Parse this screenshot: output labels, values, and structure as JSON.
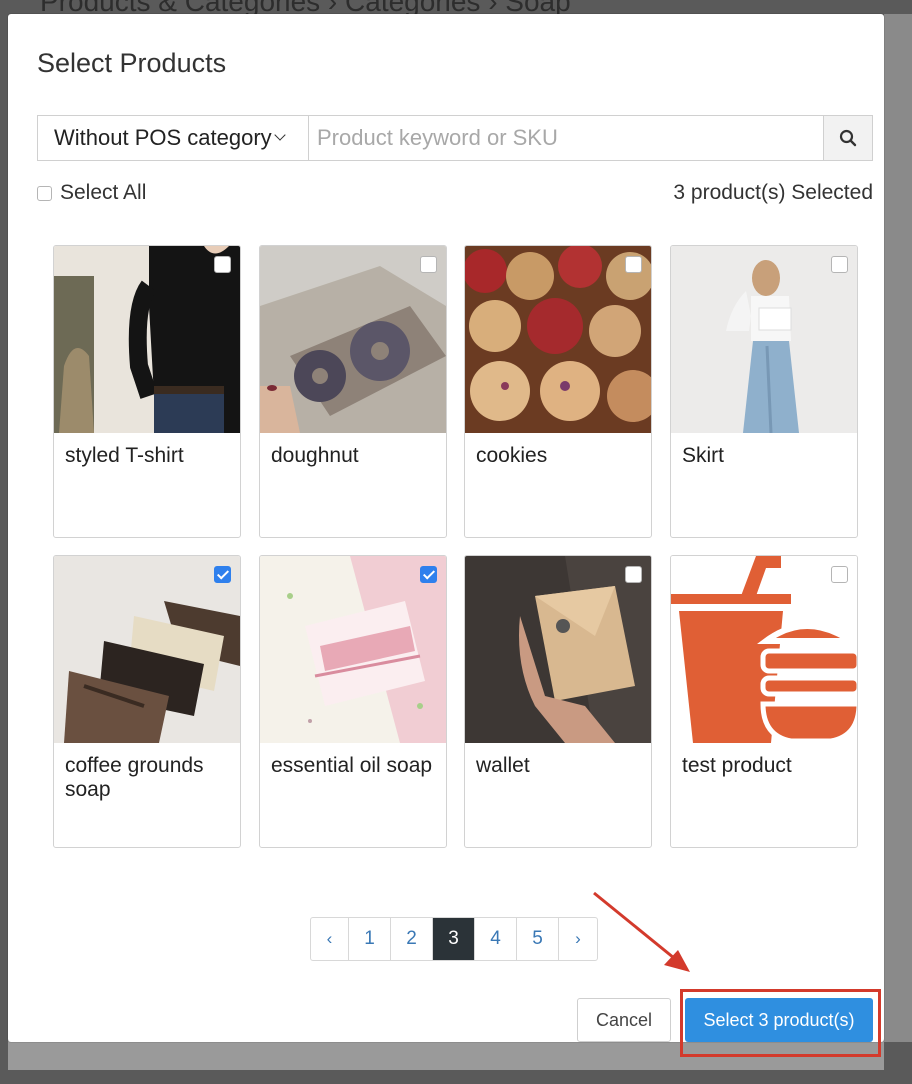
{
  "background": {
    "breadcrumb": "Products & Categories  ›  Categories  ›  Soap"
  },
  "modal": {
    "title": "Select Products",
    "category_filter": "Without POS category",
    "search_placeholder": "Product keyword or SKU",
    "select_all_label": "Select All",
    "selected_count_text": "3 product(s) Selected"
  },
  "products": [
    {
      "name": "styled T-shirt",
      "checked": false
    },
    {
      "name": "doughnut",
      "checked": false
    },
    {
      "name": "cookies",
      "checked": false
    },
    {
      "name": "Skirt",
      "checked": false
    },
    {
      "name": "coffee grounds soap",
      "checked": true
    },
    {
      "name": "essential oil soap",
      "checked": true
    },
    {
      "name": "wallet",
      "checked": false
    },
    {
      "name": "test product",
      "checked": false
    }
  ],
  "pagination": {
    "prev": "‹",
    "pages": [
      "1",
      "2",
      "3",
      "4",
      "5"
    ],
    "current": "3",
    "next": "›"
  },
  "footer": {
    "cancel_label": "Cancel",
    "select_label": "Select 3 product(s)"
  },
  "colors": {
    "primary": "#2f8fe0",
    "checkbox_checked": "#2f80ed",
    "annotation": "#d33a2c",
    "active_page": "#2b3338"
  }
}
